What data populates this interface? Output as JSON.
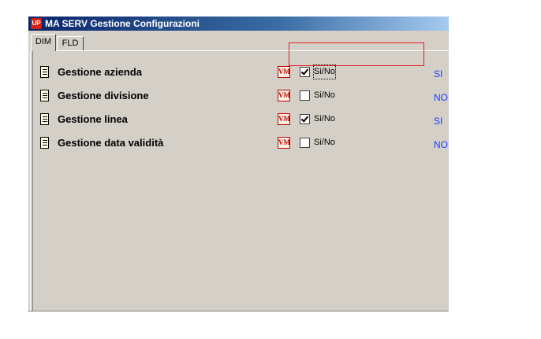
{
  "window": {
    "app_icon_text": "UP",
    "title": "MA SERV Gestione Configurazioni"
  },
  "tabs": [
    {
      "label": "DIM",
      "selected": true
    },
    {
      "label": "FLD",
      "selected": false
    }
  ],
  "colors": {
    "value_text": "#1a3cff",
    "highlight": "#e02020"
  },
  "rows": [
    {
      "label": "Gestione azienda",
      "icon": "document-icon",
      "type_icon": "VM",
      "checked": true,
      "checkbox_label": "Si/No",
      "value": "SI",
      "focused": true
    },
    {
      "label": "Gestione divisione",
      "icon": "document-icon",
      "type_icon": "VM",
      "checked": false,
      "checkbox_label": "Si/No",
      "value": "NO",
      "focused": false
    },
    {
      "label": "Gestione linea",
      "icon": "document-icon",
      "type_icon": "VM",
      "checked": true,
      "checkbox_label": "Si/No",
      "value": "SI",
      "focused": false
    },
    {
      "label": "Gestione data validità",
      "icon": "document-icon",
      "type_icon": "VM",
      "checked": false,
      "checkbox_label": "Si/No",
      "value": "NO",
      "focused": false
    }
  ]
}
